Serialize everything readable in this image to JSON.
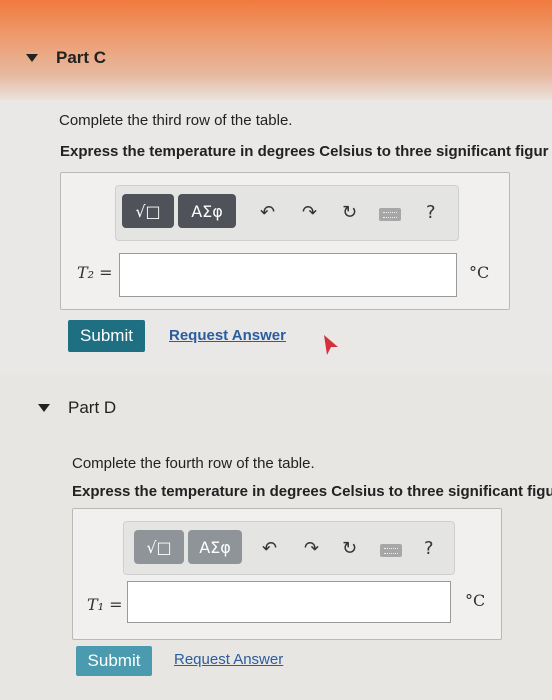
{
  "part_c": {
    "title": "Part C",
    "instruction": "Complete the third row of the table.",
    "instruction_bold": "Express the temperature in degrees Celsius to three significant figur",
    "toolbar": {
      "templates_label": "√□",
      "symbols_label": "ΑΣφ",
      "help_label": "?"
    },
    "variable_label": "T₂ =",
    "input_value": "",
    "unit": "°C",
    "submit_label": "Submit",
    "request_label": "Request Answer"
  },
  "part_d": {
    "title": "Part D",
    "instruction": "Complete the fourth row of the table.",
    "instruction_bold": "Express the temperature in degrees Celsius to three significant figures",
    "toolbar": {
      "templates_label": "√□",
      "symbols_label": "ΑΣφ",
      "help_label": "?"
    },
    "variable_label": "T₁ =",
    "input_value": "",
    "unit": "°C",
    "submit_label": "Submit",
    "request_label": "Request Answer"
  },
  "colors": {
    "accent": "#1f6f83",
    "link": "#2b5c9e",
    "header_band": "#f07a3e"
  }
}
